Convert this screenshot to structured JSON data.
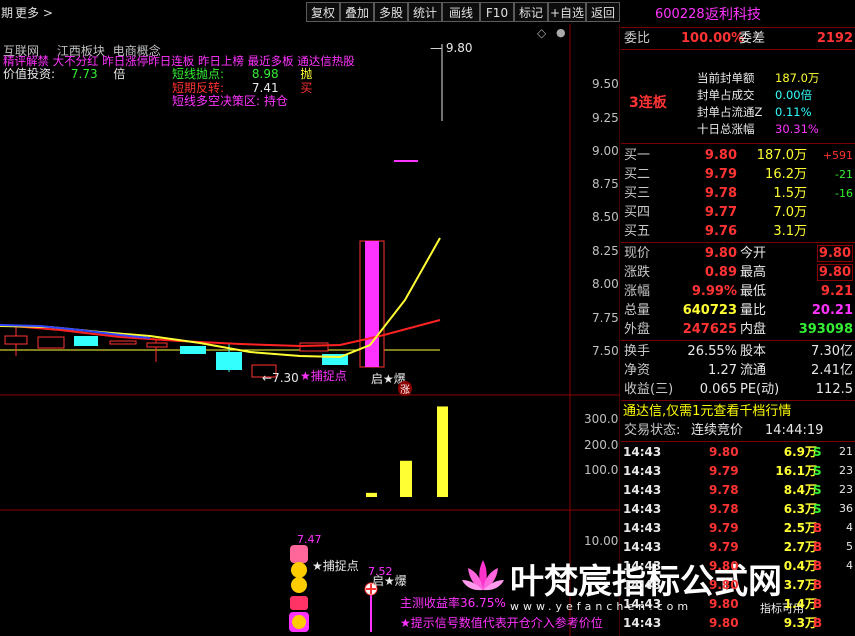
{
  "toolbar": {
    "left_cut": "期",
    "more": "更多",
    "more_arrow": ">",
    "buttons": [
      "复权",
      "叠加",
      "多股",
      "统计",
      "画线",
      "F10",
      "标记",
      "+自选",
      "返回"
    ]
  },
  "overlay_text": {
    "line1_items": [
      "互联网",
      "江西板块",
      "电商概念"
    ],
    "line2": "精评解禁 大不分红 昨日涨停昨日连板 昨日上榜 最近多板 通达信热股",
    "value_invest_label": "价值投资:",
    "value_invest_value": "7.73",
    "value_invest_unit": "倍",
    "short_point_label": "短线抛点:",
    "short_point_value": "8.98",
    "short_point_action": "抛",
    "short_rebound_label": "短期反转:",
    "short_rebound_value": "7.41",
    "short_rebound_action": "买",
    "decision_label": "短线多空决策区:",
    "decision_value": "持仓",
    "high_label": "9.80",
    "low_label": "7.30",
    "low_arrow": "←",
    "catch_label": "★捕捉点",
    "start_label": "启★爆",
    "up_badge": "涨",
    "diamond": "◇",
    "dot": "●"
  },
  "price_axis": [
    "9.50",
    "9.25",
    "9.00",
    "8.75",
    "8.50",
    "8.25",
    "8.00",
    "7.75",
    "7.50"
  ],
  "volume_axis": [
    "300.0",
    "200.0",
    "100.0"
  ],
  "indicator_axis": [
    "10.00"
  ],
  "indicator_text": {
    "val_747": "7.47",
    "val_752": "7.52",
    "catch": "捕捉点",
    "start": "启★爆",
    "profit": "主测收益率36.75%",
    "hint": "★提示信号数值代表开仓介入参考价位"
  },
  "chart_data": {
    "type": "candlestick",
    "price_ylim": [
      7.3,
      9.8
    ],
    "volume_bars": [
      14,
      122,
      305
    ],
    "volume_ylim": [
      0,
      320
    ]
  },
  "watermark": {
    "text": "叶梵宸指标公式网",
    "url": "www.yefanchen.com",
    "tag": "指标可用"
  },
  "side": {
    "code": "600228",
    "name": "返利科技",
    "weibi_label": "委比",
    "weibi_value": "100.00%",
    "weicha_label": "委差",
    "weicha_value": "2192",
    "lianban": "3连板",
    "seal_amount_label": "当前封单额",
    "seal_amount_value": "187.0万",
    "seal_deal_label": "封单占成交",
    "seal_deal_value": "0.00倍",
    "seal_float_label": "封单占流通Z",
    "seal_float_value": "0.11%",
    "ten_day_label": "十日总涨幅",
    "ten_day_value": "30.31%",
    "buys": [
      {
        "label": "买一",
        "price": "9.80",
        "vol": "187.0万",
        "chg": "+591"
      },
      {
        "label": "买二",
        "price": "9.79",
        "vol": "16.2万",
        "chg": "-21"
      },
      {
        "label": "买三",
        "price": "9.78",
        "vol": "1.5万",
        "chg": "-16"
      },
      {
        "label": "买四",
        "price": "9.77",
        "vol": "7.0万",
        "chg": ""
      },
      {
        "label": "买五",
        "price": "9.76",
        "vol": "3.1万",
        "chg": ""
      }
    ],
    "quote": [
      {
        "l1": "现价",
        "v1": "9.80",
        "l2": "今开",
        "v2": "9.80"
      },
      {
        "l1": "涨跌",
        "v1": "0.89",
        "l2": "最高",
        "v2": "9.80"
      },
      {
        "l1": "涨幅",
        "v1": "9.99%",
        "l2": "最低",
        "v2": "9.21"
      },
      {
        "l1": "总量",
        "v1": "640723",
        "l2": "量比",
        "v2": "20.21"
      },
      {
        "l1": "外盘",
        "v1": "247625",
        "l2": "内盘",
        "v2": "393098"
      }
    ],
    "fund": [
      {
        "l1": "换手",
        "v1": "26.55%",
        "l2": "股本",
        "v2": "7.30亿"
      },
      {
        "l1": "净资",
        "v1": "1.27",
        "l2": "流通",
        "v2": "2.41亿"
      },
      {
        "l1": "收益(三)",
        "v1": "0.065",
        "l2": "PE(动)",
        "v2": "112.5"
      }
    ],
    "promo": "通达信,仅需1元查看千档行情",
    "status_label": "交易状态:",
    "status_value": "连续竞价",
    "status_time": "14:44:19",
    "trades": [
      {
        "t": "14:43",
        "p": "9.80",
        "v": "6.9万",
        "d": "S"
      },
      {
        "t": "14:43",
        "p": "9.79",
        "v": "16.1万",
        "d": "S"
      },
      {
        "t": "14:43",
        "p": "9.78",
        "v": "8.4万",
        "d": "S"
      },
      {
        "t": "14:43",
        "p": "9.78",
        "v": "6.3万",
        "d": "S"
      },
      {
        "t": "14:43",
        "p": "9.79",
        "v": "2.5万",
        "d": "B"
      },
      {
        "t": "14:43",
        "p": "9.79",
        "v": "2.7万",
        "d": "B"
      },
      {
        "t": "14:43",
        "p": "9.80",
        "v": "0.4万",
        "d": "B"
      },
      {
        "t": "14:43",
        "p": "9.80",
        "v": "3.7万",
        "d": "B"
      },
      {
        "t": "14:43",
        "p": "9.80",
        "v": "1.4万",
        "d": "B"
      },
      {
        "t": "14:43",
        "p": "9.80",
        "v": "9.3万",
        "d": "B"
      }
    ],
    "trade_counts": [
      "21",
      "23",
      "23",
      "36",
      "4",
      "5",
      "4",
      "",
      "",
      ""
    ]
  }
}
